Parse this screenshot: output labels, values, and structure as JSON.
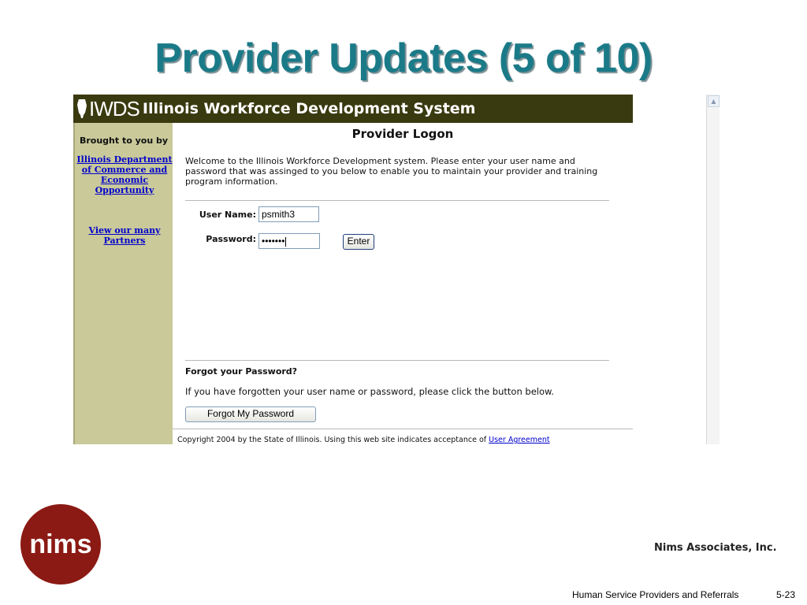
{
  "slide": {
    "title": "Provider Updates (5 of 10)",
    "company": "Nims Associates, Inc.",
    "footer_text": "Human Service Providers and Referrals",
    "page_number": "5-23",
    "logo_text": "nims"
  },
  "banner": {
    "logo": "IWDS",
    "name": "Illinois Workforce Development System"
  },
  "sidebar": {
    "heading": "Brought to you by",
    "link1_lines": [
      "Illinois Department",
      "of Commerce and",
      "Economic",
      "Opportunity"
    ],
    "link2_lines": [
      "View our many",
      "Partners"
    ]
  },
  "content": {
    "heading": "Provider Logon",
    "intro_lines": [
      "Welcome to the Illinois Workforce Development system. Please enter your user name and",
      "password that was assinged to you below to enable you to maintain your provider and training",
      "program information."
    ],
    "username_label": "User Name:",
    "username_value": "psmith3",
    "password_label": "Password:",
    "password_value": "•••••••",
    "enter_label": "Enter",
    "forgot_heading": "Forgot your Password?",
    "forgot_text": "If you have forgotten your user name or password, please click the button below.",
    "forgot_button": "Forgot My Password",
    "copyright_text": "Copyright 2004 by the State of Illinois. Using this web site indicates acceptance of ",
    "agreement_link": "User Agreement"
  },
  "colors": {
    "title": "#1a7a88",
    "banner": "#3a3a10",
    "sidebar": "#c9c99a",
    "logo_red": "#8b1a14"
  },
  "icons": {
    "state": "illinois-state-icon",
    "scroll": "scroll-up-arrow-icon"
  }
}
